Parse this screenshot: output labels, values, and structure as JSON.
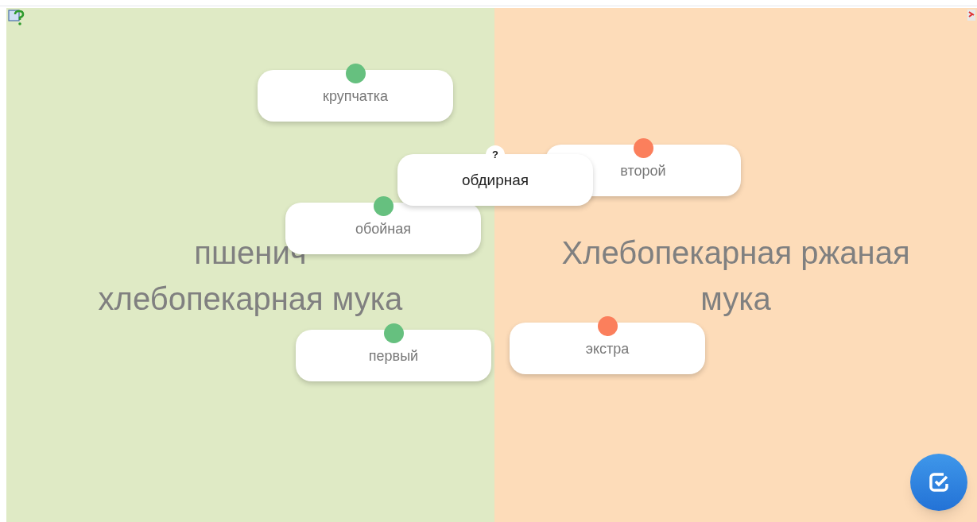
{
  "categories": [
    {
      "lines": [
        "пшенич",
        "хлебопекарная мука"
      ]
    },
    {
      "lines": [
        "Хлебопекарная ржаная",
        "мука"
      ]
    }
  ],
  "cards": [
    {
      "kind": "placed",
      "text": "крупчатка",
      "color": "#66c07f"
    },
    {
      "kind": "placed",
      "text": "второй",
      "color": "#fb7f5c"
    },
    {
      "kind": "placed",
      "text": "обойная",
      "color": "#66c07f"
    },
    {
      "kind": "placed",
      "text": "первый",
      "color": "#66c07f"
    },
    {
      "kind": "placed",
      "text": "экстра",
      "color": "#fb7f5c"
    },
    {
      "kind": "dragging",
      "text": "обдирная",
      "marker": "?"
    }
  ]
}
